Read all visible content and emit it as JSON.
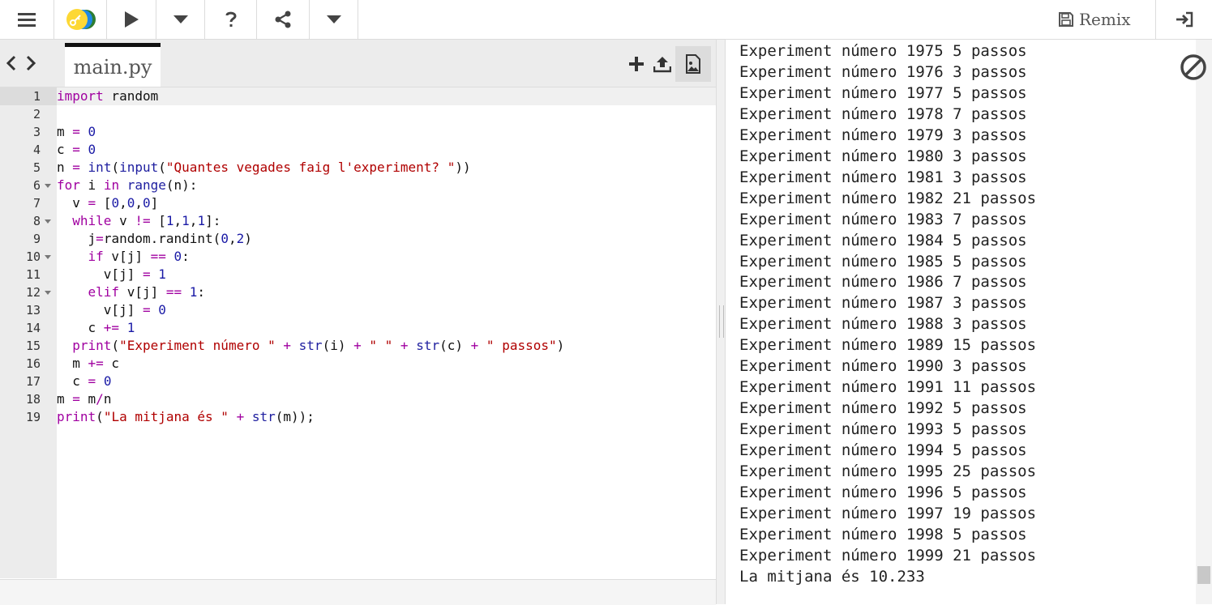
{
  "toolbar": {
    "remix_label": "Remix",
    "icons": [
      "menu-icon",
      "project-logo",
      "run-icon",
      "chevron-down-icon",
      "help-icon",
      "share-icon",
      "chevron-down-icon",
      "save-icon",
      "login-icon"
    ]
  },
  "editor": {
    "tab_label": "main.py",
    "line_numbers": [
      "1",
      "2",
      "3",
      "4",
      "5",
      "6",
      "7",
      "8",
      "9",
      "10",
      "11",
      "12",
      "13",
      "14",
      "15",
      "16",
      "17",
      "18",
      "19"
    ],
    "fold_lines": [
      6,
      8,
      10,
      12
    ]
  },
  "console": {
    "lines": [
      "Experiment número 1975 5 passos",
      "Experiment número 1976 3 passos",
      "Experiment número 1977 5 passos",
      "Experiment número 1978 7 passos",
      "Experiment número 1979 3 passos",
      "Experiment número 1980 3 passos",
      "Experiment número 1981 3 passos",
      "Experiment número 1982 21 passos",
      "Experiment número 1983 7 passos",
      "Experiment número 1984 5 passos",
      "Experiment número 1985 5 passos",
      "Experiment número 1986 7 passos",
      "Experiment número 1987 3 passos",
      "Experiment número 1988 3 passos",
      "Experiment número 1989 15 passos",
      "Experiment número 1990 3 passos",
      "Experiment número 1991 11 passos",
      "Experiment número 1992 5 passos",
      "Experiment número 1993 5 passos",
      "Experiment número 1994 5 passos",
      "Experiment número 1995 25 passos",
      "Experiment número 1996 5 passos",
      "Experiment número 1997 19 passos",
      "Experiment número 1998 5 passos",
      "Experiment número 1999 21 passos",
      "La mitjana és 10.233"
    ]
  },
  "code": [
    [
      {
        "t": "import",
        "c": "k"
      },
      {
        "t": " random",
        "c": "p"
      }
    ],
    [],
    [
      {
        "t": "m ",
        "c": "p"
      },
      {
        "t": "=",
        "c": "o"
      },
      {
        "t": " ",
        "c": "p"
      },
      {
        "t": "0",
        "c": "n"
      }
    ],
    [
      {
        "t": "c ",
        "c": "p"
      },
      {
        "t": "=",
        "c": "o"
      },
      {
        "t": " ",
        "c": "p"
      },
      {
        "t": "0",
        "c": "n"
      }
    ],
    [
      {
        "t": "n ",
        "c": "p"
      },
      {
        "t": "=",
        "c": "o"
      },
      {
        "t": " ",
        "c": "p"
      },
      {
        "t": "int",
        "c": "b"
      },
      {
        "t": "(",
        "c": "p"
      },
      {
        "t": "input",
        "c": "b"
      },
      {
        "t": "(",
        "c": "p"
      },
      {
        "t": "\"Quantes vegades faig l'experiment? \"",
        "c": "s"
      },
      {
        "t": "))",
        "c": "p"
      }
    ],
    [
      {
        "t": "for",
        "c": "k"
      },
      {
        "t": " i ",
        "c": "p"
      },
      {
        "t": "in",
        "c": "k"
      },
      {
        "t": " ",
        "c": "p"
      },
      {
        "t": "range",
        "c": "b"
      },
      {
        "t": "(n):",
        "c": "p"
      }
    ],
    [
      {
        "t": "  v ",
        "c": "p"
      },
      {
        "t": "=",
        "c": "o"
      },
      {
        "t": " [",
        "c": "p"
      },
      {
        "t": "0",
        "c": "n"
      },
      {
        "t": ",",
        "c": "p"
      },
      {
        "t": "0",
        "c": "n"
      },
      {
        "t": ",",
        "c": "p"
      },
      {
        "t": "0",
        "c": "n"
      },
      {
        "t": "]",
        "c": "p"
      }
    ],
    [
      {
        "t": "  ",
        "c": "p"
      },
      {
        "t": "while",
        "c": "k"
      },
      {
        "t": " v ",
        "c": "p"
      },
      {
        "t": "!=",
        "c": "o"
      },
      {
        "t": " [",
        "c": "p"
      },
      {
        "t": "1",
        "c": "n"
      },
      {
        "t": ",",
        "c": "p"
      },
      {
        "t": "1",
        "c": "n"
      },
      {
        "t": ",",
        "c": "p"
      },
      {
        "t": "1",
        "c": "n"
      },
      {
        "t": "]:",
        "c": "p"
      }
    ],
    [
      {
        "t": "    j",
        "c": "p"
      },
      {
        "t": "=",
        "c": "o"
      },
      {
        "t": "random.randint(",
        "c": "p"
      },
      {
        "t": "0",
        "c": "n"
      },
      {
        "t": ",",
        "c": "p"
      },
      {
        "t": "2",
        "c": "n"
      },
      {
        "t": ")",
        "c": "p"
      }
    ],
    [
      {
        "t": "    ",
        "c": "p"
      },
      {
        "t": "if",
        "c": "k"
      },
      {
        "t": " v[j] ",
        "c": "p"
      },
      {
        "t": "==",
        "c": "o"
      },
      {
        "t": " ",
        "c": "p"
      },
      {
        "t": "0",
        "c": "n"
      },
      {
        "t": ":",
        "c": "p"
      }
    ],
    [
      {
        "t": "      v[j] ",
        "c": "p"
      },
      {
        "t": "=",
        "c": "o"
      },
      {
        "t": " ",
        "c": "p"
      },
      {
        "t": "1",
        "c": "n"
      }
    ],
    [
      {
        "t": "    ",
        "c": "p"
      },
      {
        "t": "elif",
        "c": "k"
      },
      {
        "t": " v[j] ",
        "c": "p"
      },
      {
        "t": "==",
        "c": "o"
      },
      {
        "t": " ",
        "c": "p"
      },
      {
        "t": "1",
        "c": "n"
      },
      {
        "t": ":",
        "c": "p"
      }
    ],
    [
      {
        "t": "      v[j] ",
        "c": "p"
      },
      {
        "t": "=",
        "c": "o"
      },
      {
        "t": " ",
        "c": "p"
      },
      {
        "t": "0",
        "c": "n"
      }
    ],
    [
      {
        "t": "    c ",
        "c": "p"
      },
      {
        "t": "+=",
        "c": "o"
      },
      {
        "t": " ",
        "c": "p"
      },
      {
        "t": "1",
        "c": "n"
      }
    ],
    [
      {
        "t": "  ",
        "c": "p"
      },
      {
        "t": "print",
        "c": "k"
      },
      {
        "t": "(",
        "c": "p"
      },
      {
        "t": "\"Experiment número \"",
        "c": "s"
      },
      {
        "t": " ",
        "c": "p"
      },
      {
        "t": "+",
        "c": "o"
      },
      {
        "t": " ",
        "c": "p"
      },
      {
        "t": "str",
        "c": "b"
      },
      {
        "t": "(i) ",
        "c": "p"
      },
      {
        "t": "+",
        "c": "o"
      },
      {
        "t": " ",
        "c": "p"
      },
      {
        "t": "\" \"",
        "c": "s"
      },
      {
        "t": " ",
        "c": "p"
      },
      {
        "t": "+",
        "c": "o"
      },
      {
        "t": " ",
        "c": "p"
      },
      {
        "t": "str",
        "c": "b"
      },
      {
        "t": "(c) ",
        "c": "p"
      },
      {
        "t": "+",
        "c": "o"
      },
      {
        "t": " ",
        "c": "p"
      },
      {
        "t": "\" passos\"",
        "c": "s"
      },
      {
        "t": ")",
        "c": "p"
      }
    ],
    [
      {
        "t": "  m ",
        "c": "p"
      },
      {
        "t": "+=",
        "c": "o"
      },
      {
        "t": " c",
        "c": "p"
      }
    ],
    [
      {
        "t": "  c ",
        "c": "p"
      },
      {
        "t": "=",
        "c": "o"
      },
      {
        "t": " ",
        "c": "p"
      },
      {
        "t": "0",
        "c": "n"
      }
    ],
    [
      {
        "t": "m ",
        "c": "p"
      },
      {
        "t": "=",
        "c": "o"
      },
      {
        "t": " m",
        "c": "p"
      },
      {
        "t": "/",
        "c": "o"
      },
      {
        "t": "n",
        "c": "p"
      }
    ],
    [
      {
        "t": "print",
        "c": "k"
      },
      {
        "t": "(",
        "c": "p"
      },
      {
        "t": "\"La mitjana és \"",
        "c": "s"
      },
      {
        "t": " ",
        "c": "p"
      },
      {
        "t": "+",
        "c": "o"
      },
      {
        "t": " ",
        "c": "p"
      },
      {
        "t": "str",
        "c": "b"
      },
      {
        "t": "(m));",
        "c": "p"
      }
    ]
  ]
}
